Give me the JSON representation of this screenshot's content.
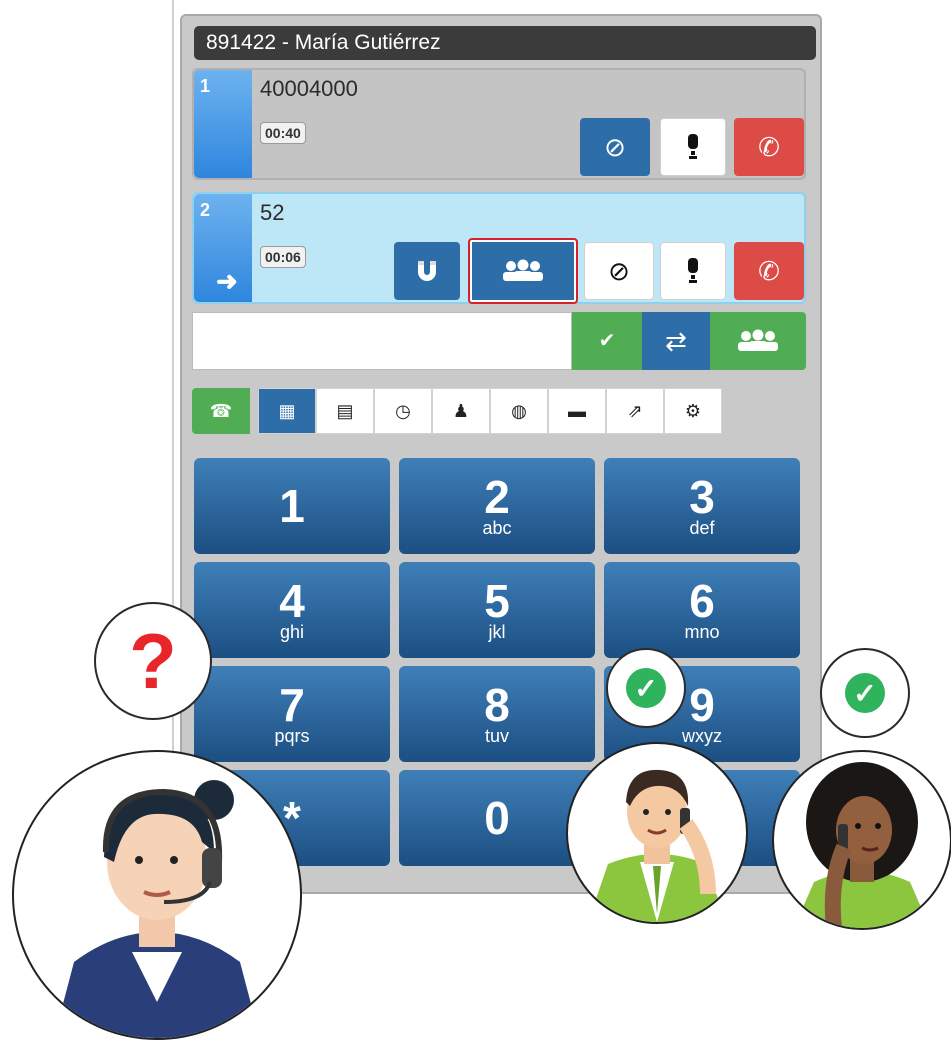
{
  "window": {
    "title": "891422 - María Gutiérrez"
  },
  "lines": [
    {
      "index": "1",
      "number": "40004000",
      "timer": "00:40"
    },
    {
      "index": "2",
      "number": "52",
      "timer": "00:06"
    }
  ],
  "tabs": [
    "phone-icon",
    "keypad-icon",
    "contacts-list-icon",
    "history-icon",
    "user-icon",
    "globe-icon",
    "chat-icon",
    "external-icon",
    "settings-icon"
  ],
  "keypad": [
    {
      "digit": "1",
      "letters": ""
    },
    {
      "digit": "2",
      "letters": "abc"
    },
    {
      "digit": "3",
      "letters": "def"
    },
    {
      "digit": "4",
      "letters": "ghi"
    },
    {
      "digit": "5",
      "letters": "jkl"
    },
    {
      "digit": "6",
      "letters": "mno"
    },
    {
      "digit": "7",
      "letters": "pqrs"
    },
    {
      "digit": "8",
      "letters": "tuv"
    },
    {
      "digit": "9",
      "letters": "wxyz"
    },
    {
      "digit": "*",
      "letters": ""
    },
    {
      "digit": "0",
      "letters": ""
    },
    {
      "digit": "#",
      "letters": ""
    }
  ],
  "colors": {
    "accent_blue": "#2e6ea8",
    "hangup_red": "#dc4b45",
    "confirm_green": "#50ad54",
    "highlight_red": "#d6232a",
    "active_line": "#bde7f7"
  },
  "overlay": {
    "question_mark": "?",
    "check_mark": "✓"
  }
}
